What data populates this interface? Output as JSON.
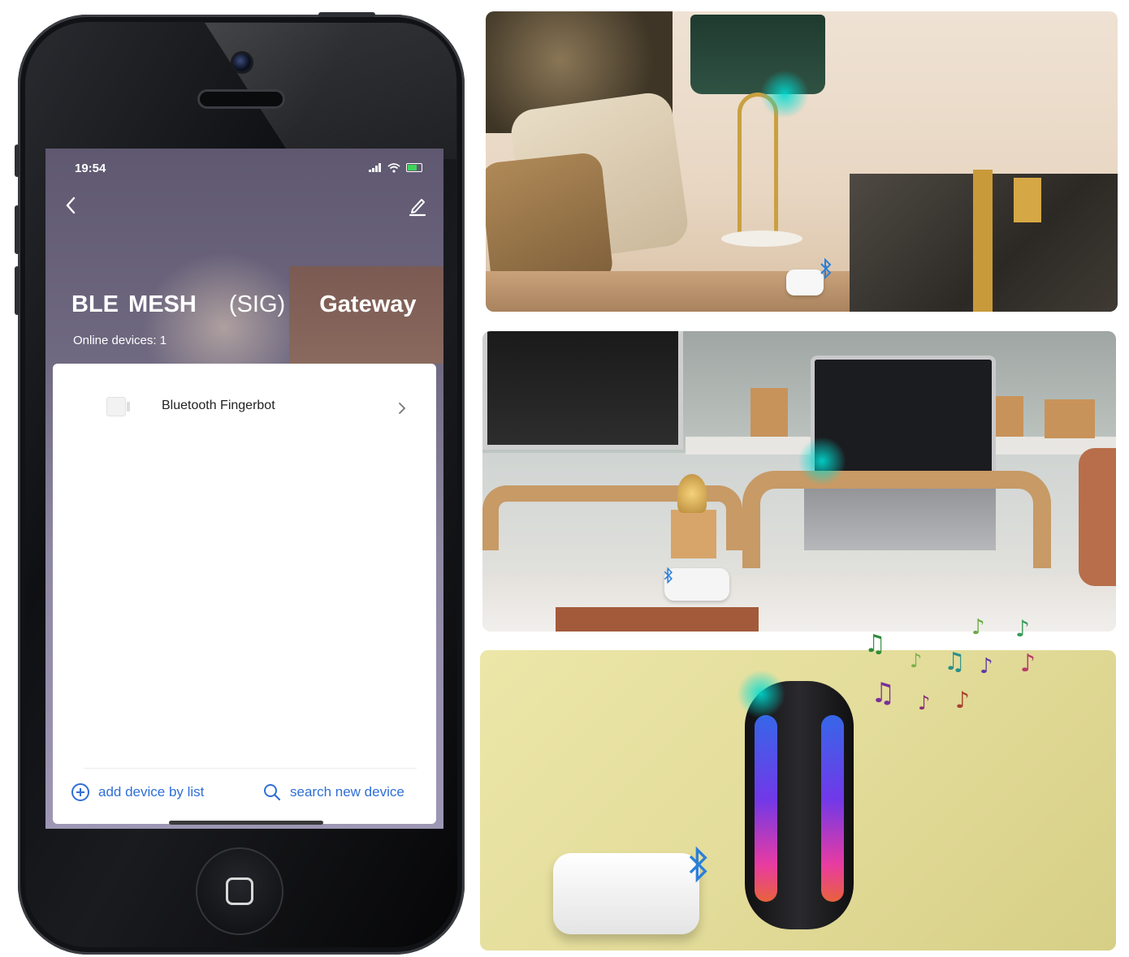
{
  "status_bar": {
    "time": "19:54"
  },
  "header": {
    "title_part1": "BLE MESH",
    "title_part2": "(SIG)",
    "title_part3": "Gateway",
    "online_devices": "Online devices: 1"
  },
  "devices": [
    {
      "name": "Bluetooth Fingerbot"
    }
  ],
  "actions": {
    "add_by_list": "add device by list",
    "search_new": "search new device"
  },
  "colors": {
    "accent": "#2f6fd6",
    "bluetooth": "#2b7fd9",
    "pulse": "#00dcd2"
  }
}
